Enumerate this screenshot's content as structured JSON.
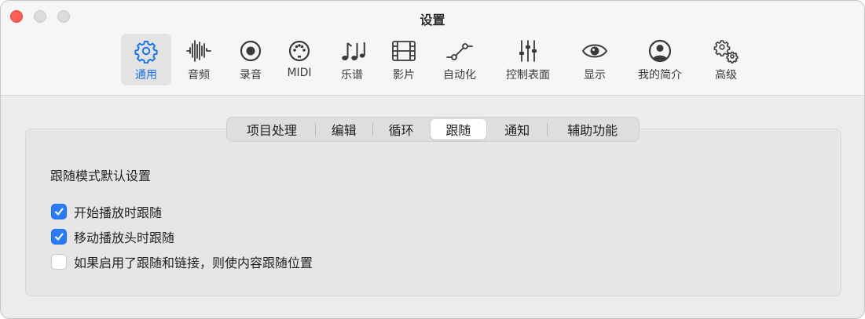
{
  "window": {
    "title": "设置"
  },
  "toolbar": {
    "items": [
      {
        "label": "通用",
        "icon": "gear-icon",
        "selected": true
      },
      {
        "label": "音频",
        "icon": "waveform-icon"
      },
      {
        "label": "录音",
        "icon": "record-icon"
      },
      {
        "label": "MIDI",
        "icon": "midi-icon"
      },
      {
        "label": "乐谱",
        "icon": "music-notes-icon"
      },
      {
        "label": "影片",
        "icon": "film-icon"
      },
      {
        "label": "自动化",
        "icon": "automation-icon"
      },
      {
        "label": "控制表面",
        "icon": "sliders-icon"
      },
      {
        "label": "显示",
        "icon": "eye-icon"
      },
      {
        "label": "我的简介",
        "icon": "person-icon"
      },
      {
        "label": "高级",
        "icon": "gears-icon"
      }
    ]
  },
  "tabs": {
    "items": [
      {
        "label": "项目处理"
      },
      {
        "label": "编辑"
      },
      {
        "label": "循环"
      },
      {
        "label": "跟随",
        "selected": true
      },
      {
        "label": "通知"
      },
      {
        "label": "辅助功能"
      }
    ]
  },
  "section": {
    "title": "跟随模式默认设置",
    "options": [
      {
        "label": "开始播放时跟随",
        "checked": true
      },
      {
        "label": "移动播放头时跟随",
        "checked": true
      },
      {
        "label": "如果启用了跟随和链接，则使内容跟随位置",
        "checked": false
      }
    ]
  },
  "colors": {
    "accent": "#2b7bf6",
    "close_button": "#fe5f57"
  }
}
